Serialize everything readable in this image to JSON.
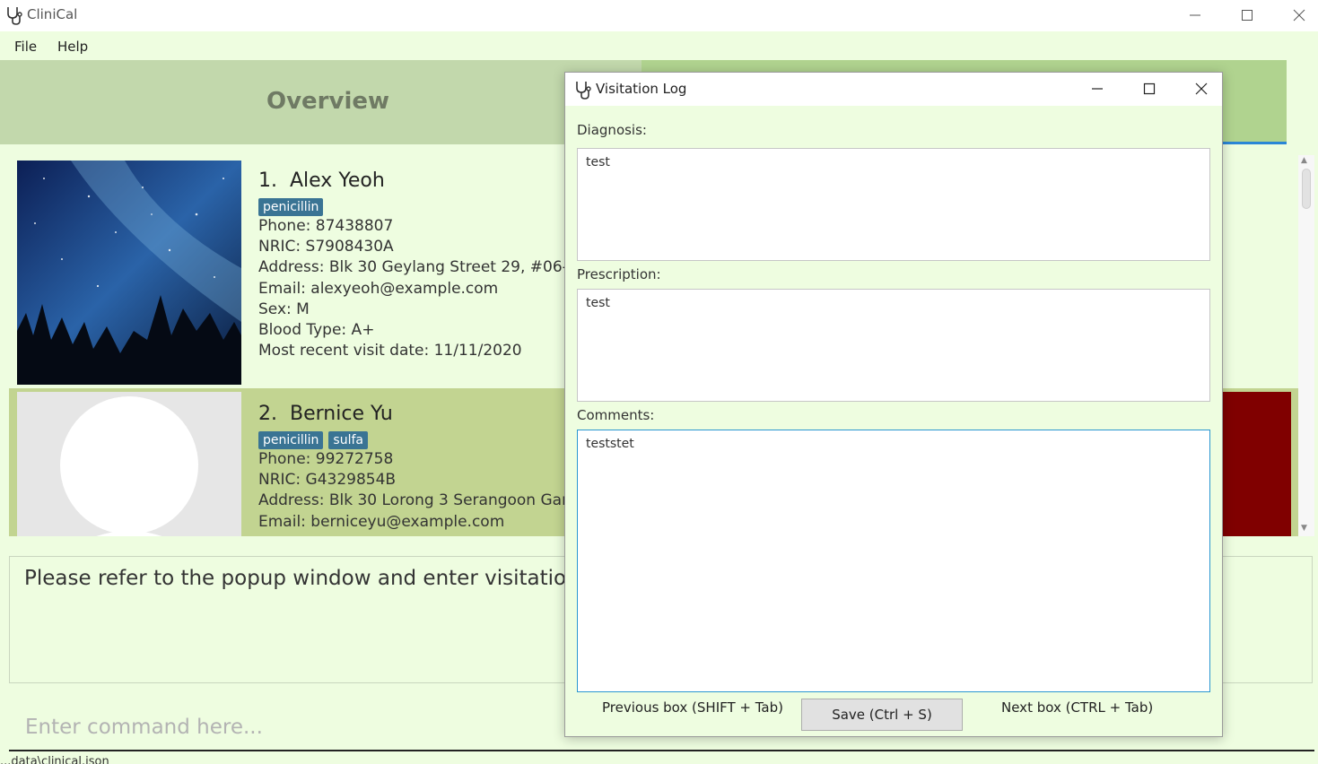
{
  "window": {
    "title": "CliniCal"
  },
  "menu": {
    "file": "File",
    "help": "Help"
  },
  "tabs": {
    "overview": "Overview"
  },
  "patients": [
    {
      "index": "1.",
      "name": "Alex Yeoh",
      "tags": [
        "penicillin"
      ],
      "phone": "Phone: 87438807",
      "nric": "NRIC: S7908430A",
      "address": "Address: Blk 30 Geylang Street 29, #06-40",
      "email": "Email: alexyeoh@example.com",
      "sex": "Sex: M",
      "blood": "Blood Type: A+",
      "visit": "Most recent visit date: 11/11/2020"
    },
    {
      "index": "2.",
      "name": "Bernice Yu",
      "tags": [
        "penicillin",
        "sulfa"
      ],
      "phone": "Phone: 99272758",
      "nric": "NRIC: G4329854B",
      "address": "Address: Blk 30 Lorong 3 Serangoon Gardens",
      "email": "Email: berniceyu@example.com"
    }
  ],
  "result": {
    "text": "Please refer to the popup window and enter visitation log."
  },
  "command": {
    "placeholder": "Enter command here..."
  },
  "status": {
    "text": "...data\\clinical.json"
  },
  "popup": {
    "title": "Visitation Log",
    "diagnosis_label": "Diagnosis:",
    "diagnosis_value": "test",
    "prescription_label": "Prescription:",
    "prescription_value": "test",
    "comments_label": "Comments:",
    "comments_value": "teststet",
    "prev_label": "Previous box (SHIFT + Tab)",
    "save_label": "Save (Ctrl + S)",
    "next_label": "Next box (CTRL + Tab)"
  }
}
